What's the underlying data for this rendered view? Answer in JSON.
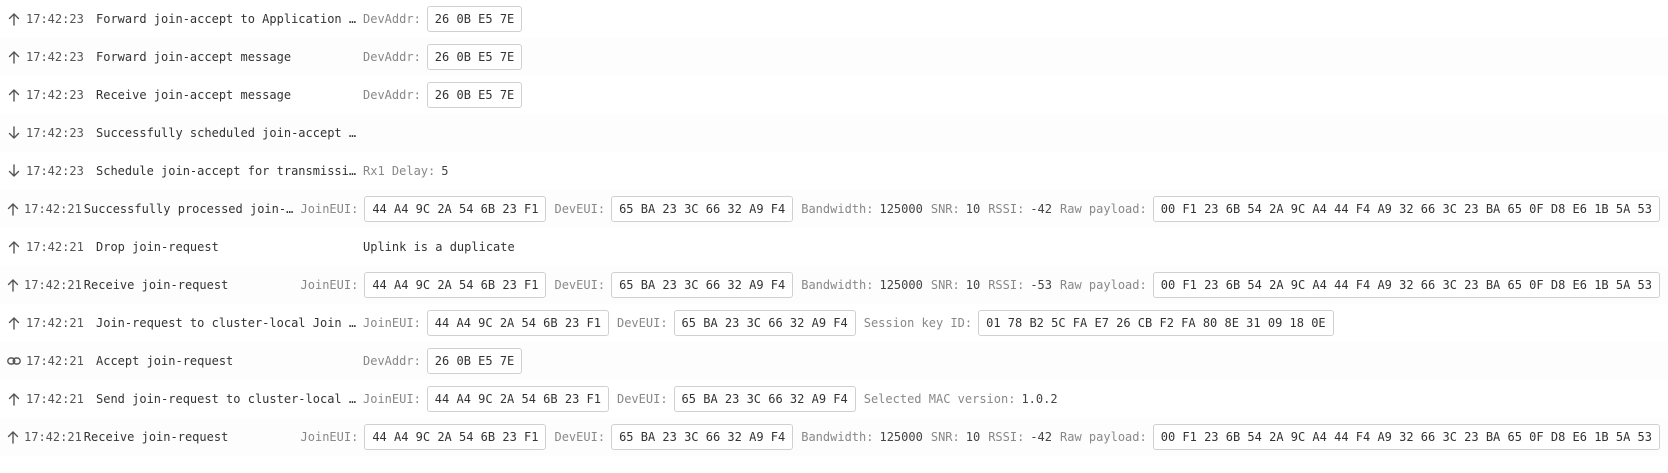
{
  "icons": {
    "up": "arrow-up-icon",
    "down": "arrow-down-icon",
    "link": "link-icon"
  },
  "events": [
    {
      "dir": "up",
      "time": "17:42:23",
      "message": "Forward join-accept to Application Se…",
      "fields": [
        {
          "label": "DevAddr:",
          "value": "26 0B E5 7E",
          "boxed": true
        }
      ]
    },
    {
      "dir": "up",
      "time": "17:42:23",
      "message": "Forward join-accept message",
      "fields": [
        {
          "label": "DevAddr:",
          "value": "26 0B E5 7E",
          "boxed": true
        }
      ]
    },
    {
      "dir": "up",
      "time": "17:42:23",
      "message": "Receive join-accept message",
      "fields": [
        {
          "label": "DevAddr:",
          "value": "26 0B E5 7E",
          "boxed": true
        }
      ]
    },
    {
      "dir": "down",
      "time": "17:42:23",
      "message": "Successfully scheduled join-accept fo…",
      "fields": []
    },
    {
      "dir": "down",
      "time": "17:42:23",
      "message": "Schedule join-accept for transmission…",
      "fields": [
        {
          "label": "Rx1 Delay:",
          "value": "5",
          "boxed": false
        }
      ]
    },
    {
      "dir": "up",
      "time": "17:42:21",
      "message": "Successfully processed join-request",
      "fields": [
        {
          "label": "JoinEUI:",
          "value": "44 A4 9C 2A 54 6B 23 F1",
          "boxed": true
        },
        {
          "label": "DevEUI:",
          "value": "65 BA 23 3C 66 32 A9 F4",
          "boxed": true
        },
        {
          "label": "Bandwidth:",
          "value": "125000",
          "boxed": false
        },
        {
          "label": "SNR:",
          "value": "10",
          "boxed": false
        },
        {
          "label": "RSSI:",
          "value": "-42",
          "boxed": false
        },
        {
          "label": "Raw payload:",
          "value": "00 F1 23 6B 54 2A 9C A4 44 F4 A9 32 66 3C 23 BA 65 0F D8 E6 1B 5A 53",
          "boxed": true
        }
      ]
    },
    {
      "dir": "up",
      "time": "17:42:21",
      "message": "Drop join-request",
      "fields": [
        {
          "label": "",
          "value": "Uplink is a duplicate",
          "boxed": false
        }
      ]
    },
    {
      "dir": "up",
      "time": "17:42:21",
      "message": "Receive join-request",
      "fields": [
        {
          "label": "JoinEUI:",
          "value": "44 A4 9C 2A 54 6B 23 F1",
          "boxed": true
        },
        {
          "label": "DevEUI:",
          "value": "65 BA 23 3C 66 32 A9 F4",
          "boxed": true
        },
        {
          "label": "Bandwidth:",
          "value": "125000",
          "boxed": false
        },
        {
          "label": "SNR:",
          "value": "10",
          "boxed": false
        },
        {
          "label": "RSSI:",
          "value": "-53",
          "boxed": false
        },
        {
          "label": "Raw payload:",
          "value": "00 F1 23 6B 54 2A 9C A4 44 F4 A9 32 66 3C 23 BA 65 0F D8 E6 1B 5A 53",
          "boxed": true
        }
      ]
    },
    {
      "dir": "up",
      "time": "17:42:21",
      "message": "Join-request to cluster-local Join Se…",
      "fields": [
        {
          "label": "JoinEUI:",
          "value": "44 A4 9C 2A 54 6B 23 F1",
          "boxed": true
        },
        {
          "label": "DevEUI:",
          "value": "65 BA 23 3C 66 32 A9 F4",
          "boxed": true
        },
        {
          "label": "Session key ID:",
          "value": "01 78 B2 5C FA E7 26 CB F2 FA 80 8E 31 09 18 0E",
          "boxed": true
        }
      ]
    },
    {
      "dir": "link",
      "time": "17:42:21",
      "message": "Accept join-request",
      "fields": [
        {
          "label": "DevAddr:",
          "value": "26 0B E5 7E",
          "boxed": true
        }
      ]
    },
    {
      "dir": "up",
      "time": "17:42:21",
      "message": "Send join-request to cluster-local Jo…",
      "fields": [
        {
          "label": "JoinEUI:",
          "value": "44 A4 9C 2A 54 6B 23 F1",
          "boxed": true
        },
        {
          "label": "DevEUI:",
          "value": "65 BA 23 3C 66 32 A9 F4",
          "boxed": true
        },
        {
          "label": "Selected MAC version:",
          "value": "1.0.2",
          "boxed": false
        }
      ]
    },
    {
      "dir": "up",
      "time": "17:42:21",
      "message": "Receive join-request",
      "fields": [
        {
          "label": "JoinEUI:",
          "value": "44 A4 9C 2A 54 6B 23 F1",
          "boxed": true
        },
        {
          "label": "DevEUI:",
          "value": "65 BA 23 3C 66 32 A9 F4",
          "boxed": true
        },
        {
          "label": "Bandwidth:",
          "value": "125000",
          "boxed": false
        },
        {
          "label": "SNR:",
          "value": "10",
          "boxed": false
        },
        {
          "label": "RSSI:",
          "value": "-42",
          "boxed": false
        },
        {
          "label": "Raw payload:",
          "value": "00 F1 23 6B 54 2A 9C A4 44 F4 A9 32 66 3C 23 BA 65 0F D8 E6 1B 5A 53",
          "boxed": true
        }
      ]
    }
  ]
}
